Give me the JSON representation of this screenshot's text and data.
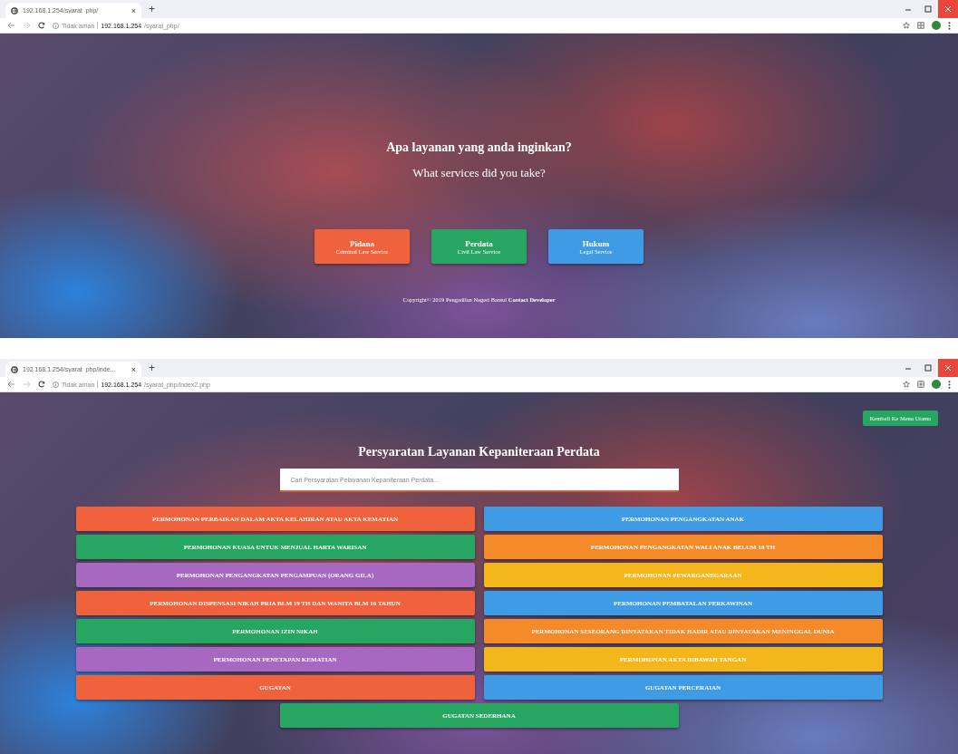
{
  "windows": [
    {
      "tab": {
        "title": "192.168.1.254/syarat_php/",
        "close": "×",
        "new_tab": "+"
      },
      "address": {
        "security": "Tidak aman",
        "host": "192.168.1.254",
        "path": "/syarat_php/"
      },
      "page": {
        "kind": "landing",
        "title": "Apa layanan yang anda inginkan?",
        "subtitle": "What services did you take?",
        "services": [
          {
            "label": "Pidana",
            "caption": "Criminal Law Service",
            "color": "#f0623c"
          },
          {
            "label": "Perdata",
            "caption": "Civil Law Service",
            "color": "#27a661"
          },
          {
            "label": "Hukum",
            "caption": "Legal Service",
            "color": "#3f9be3"
          }
        ],
        "footer": {
          "text": "Copyright© 2019 Pengadilan Negeri Bantul",
          "link": "Contact Developer"
        }
      }
    },
    {
      "tab": {
        "title": "192.168.1.254/syarat_php/inde...",
        "close": "×",
        "new_tab": "+"
      },
      "address": {
        "security": "Tidak aman",
        "host": "192.168.1.254",
        "path": "/syarat_php/index2.php"
      },
      "page": {
        "kind": "list",
        "back_button": "Kembali Ke Menu Utama",
        "title": "Persyaratan Layanan Kepaniteraan Perdata",
        "search": {
          "placeholder": "Cari Persyaratan Pelayanan Kepaniteraan Perdata..."
        },
        "items": [
          {
            "label": "PERMOHONAN PERBAIKAN DALAM AKTA KELAHIRAN ATAU AKTA KEMATIAN",
            "color": "#f0623c"
          },
          {
            "label": "PERMOHONAN PENGANGKATAN ANAK",
            "color": "#3f9be3"
          },
          {
            "label": "PERMOHONAN KUASA UNTUK MENJUAL HARTA WARISAN",
            "color": "#27a661"
          },
          {
            "label": "PERMOHONAN PENGANGKATAN WALI ANAK BELUM 18 TH",
            "color": "#f48a2a"
          },
          {
            "label": "PERMOHONAN PENGANGKATAN PENGAMPUAN (ORANG GILA)",
            "color": "#a768c2"
          },
          {
            "label": "PERMOHONAN PEWARGANEGARAAN",
            "color": "#f3b71c"
          },
          {
            "label": "PERMOHONAN DISPENSASI NIKAH PRIA BLM 19 TH DAN WANITA BLM 16 TAHUN",
            "color": "#f0623c"
          },
          {
            "label": "PERMOHONAN PEMBATALAN PERKAWINAN",
            "color": "#3f9be3"
          },
          {
            "label": "PERMOHONAN IZIN NIKAH",
            "color": "#27a661"
          },
          {
            "label": "PERMOHONAN SESEORANG DINYATAKAN TIDAK HADIR ATAU DINYATAKAN MENINGGAL DUNIA",
            "color": "#f48a2a"
          },
          {
            "label": "PERMOHONAN PENETAPAN KEMATIAN",
            "color": "#a768c2"
          },
          {
            "label": "PERMOHONAN AKTA DIBAWAH TANGAN",
            "color": "#f3b71c"
          },
          {
            "label": "GUGATAN",
            "color": "#f0623c"
          },
          {
            "label": "GUGATAN PERCERAIAN",
            "color": "#3f9be3"
          },
          {
            "label": "GUGATAN SEDERHANA",
            "color": "#27a661"
          }
        ]
      }
    }
  ]
}
